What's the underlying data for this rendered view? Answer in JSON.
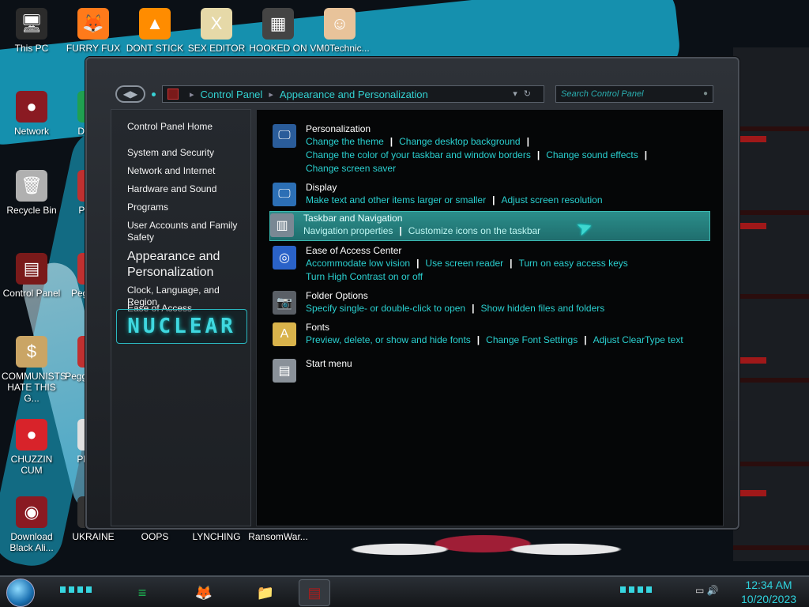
{
  "desktop": {
    "icons": [
      {
        "label": "This PC",
        "icon": "computer-icon",
        "color": "#2b2b2b"
      },
      {
        "label": "FURRY FUX",
        "icon": "firefox-icon",
        "color": "#ff7a1a"
      },
      {
        "label": "DONT STICK",
        "icon": "vlc-cone-icon",
        "color": "#ff8c00"
      },
      {
        "label": "SEX EDITOR",
        "icon": "hxd-editor-icon",
        "color": "#e6d9a8"
      },
      {
        "label": "HOOKED ON",
        "icon": "maze-icon",
        "color": "#444444"
      },
      {
        "label": "VM0Technic...",
        "icon": "doctor-icon",
        "color": "#e8c39a"
      },
      {
        "label": "Network",
        "icon": "network-icon",
        "color": "#8a1a22"
      },
      {
        "label": "Recycle Bin",
        "icon": "recycle-bin-icon",
        "color": "#b0b0b0"
      },
      {
        "label": "Control Panel",
        "icon": "control-panel-icon",
        "color": "#7a1a1a"
      },
      {
        "label": "COMMUNISTS HATE THIS G...",
        "icon": "money-bag-icon",
        "color": "#caa565"
      },
      {
        "label": "CHUZZIN CUM",
        "icon": "chuzzle-icon",
        "color": "#d8232a"
      },
      {
        "label": "Download Black Ali...",
        "icon": "alien-orb-icon",
        "color": "#8a1a22"
      },
      {
        "label": "UKRAINE",
        "icon": "app-icon",
        "color": "#333333"
      },
      {
        "label": "OOPS",
        "icon": "app-icon",
        "color": "#333333"
      },
      {
        "label": "LYNCHING",
        "icon": "app-icon",
        "color": "#333333"
      },
      {
        "label": "RansomWar...",
        "icon": "app-icon",
        "color": "#333333"
      },
      {
        "label": "D DUM",
        "icon": "app-icon",
        "color": "#20a050"
      },
      {
        "label": "Peggle",
        "icon": "peggle-icon",
        "color": "#c03030"
      },
      {
        "label": "Peggle De",
        "icon": "peggle-icon",
        "color": "#c03030"
      },
      {
        "label": "Peggle of Wa",
        "icon": "peggle-icon",
        "color": "#c03030"
      },
      {
        "label": "Plan Zo",
        "icon": "flower-icon",
        "color": "#e0e0e0"
      }
    ]
  },
  "window": {
    "address": {
      "segments": [
        "Control Panel",
        "Appearance and Personalization"
      ]
    },
    "search": {
      "placeholder": "Search Control Panel"
    },
    "sidebar": {
      "home": "Control Panel Home",
      "items": [
        "System and Security",
        "Network and Internet",
        "Hardware and Sound",
        "Programs",
        "User Accounts and Family Safety",
        "Appearance and Personalization",
        "Clock, Language, and Region",
        "Ease of Access"
      ],
      "logo_text": "NUCLEAR"
    },
    "categories": [
      {
        "title": "Personalization",
        "icon": "personalization-icon",
        "links": [
          "Change the theme",
          "Change desktop background",
          "Change the color of your taskbar and window borders",
          "Change sound effects",
          "Change screen saver"
        ]
      },
      {
        "title": "Display",
        "icon": "display-icon",
        "links": [
          "Make text and other items larger or smaller",
          "Adjust screen resolution"
        ]
      },
      {
        "title": "Taskbar and Navigation",
        "icon": "taskbar-icon",
        "links": [
          "Navigation properties",
          "Customize icons on the taskbar"
        ]
      },
      {
        "title": "Ease of Access Center",
        "icon": "ease-of-access-icon",
        "links": [
          "Accommodate low vision",
          "Use screen reader",
          "Turn on easy access keys",
          "Turn High Contrast on or off"
        ]
      },
      {
        "title": "Folder Options",
        "icon": "folder-options-icon",
        "links": [
          "Specify single- or double-click to open",
          "Show hidden files and folders"
        ]
      },
      {
        "title": "Fonts",
        "icon": "fonts-icon",
        "links": [
          "Preview, delete, or show and hide fonts",
          "Change Font Settings",
          "Adjust ClearType text"
        ]
      },
      {
        "title": "Start menu",
        "icon": "start-menu-icon",
        "links": []
      }
    ]
  },
  "taskbar": {
    "apps": [
      {
        "name": "spotify-icon",
        "color": "#1db954"
      },
      {
        "name": "firefox-icon",
        "color": "#ff7a1a"
      },
      {
        "name": "file-explorer-icon",
        "color": "#f2c14e"
      },
      {
        "name": "control-panel-icon",
        "color": "#b01a1a"
      }
    ],
    "clock": {
      "time": "12:34 AM",
      "date": "10/20/2023"
    }
  },
  "colors": {
    "accent": "#2ad0d0",
    "link": "#2ad0d0",
    "highlight": "#2b8d8a"
  }
}
